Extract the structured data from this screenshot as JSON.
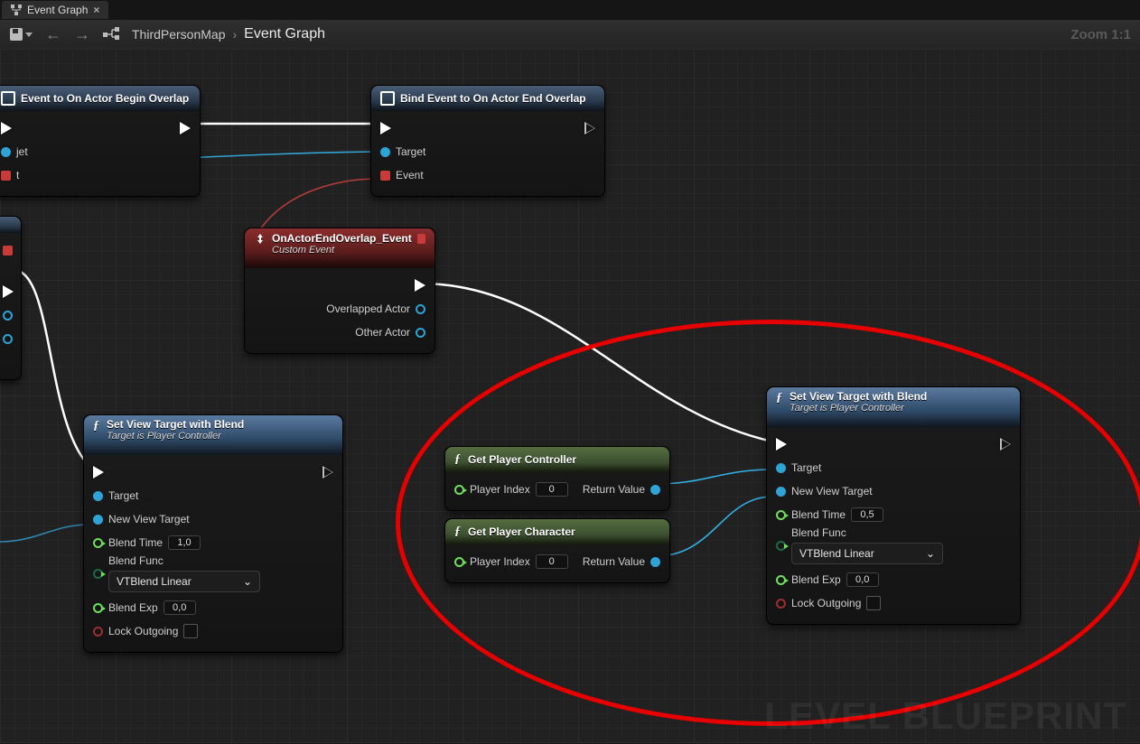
{
  "tabbar": {
    "tab_label": "Event Graph"
  },
  "toolbar": {
    "crumb_root": "ThirdPersonMap",
    "crumb_leaf": "Event Graph",
    "zoom_label": "Zoom 1:1"
  },
  "watermark": "LEVEL BLUEPRINT",
  "nodes": {
    "bind_begin": {
      "title": "Event to On Actor Begin Overlap",
      "pin_target": "jet",
      "pin_event": "t"
    },
    "bind_end": {
      "title": "Bind Event to On Actor End Overlap",
      "pin_target": "Target",
      "pin_event": "Event"
    },
    "custom_event": {
      "title": "OnActorEndOverlap_Event",
      "subtitle": "Custom Event",
      "out1": "Overlapped Actor",
      "out2": "Other Actor"
    },
    "svt_left": {
      "title": "Set View Target with Blend",
      "subtitle": "Target is Player Controller",
      "target": "Target",
      "new_view": "New View Target",
      "blend_time": "Blend Time",
      "blend_time_val": "1,0",
      "blend_func": "Blend Func",
      "blend_func_val": "VTBlend Linear",
      "blend_exp": "Blend Exp",
      "blend_exp_val": "0,0",
      "lock": "Lock Outgoing"
    },
    "svt_right": {
      "title": "Set View Target with Blend",
      "subtitle": "Target is Player Controller",
      "target": "Target",
      "new_view": "New View Target",
      "blend_time": "Blend Time",
      "blend_time_val": "0,5",
      "blend_func": "Blend Func",
      "blend_func_val": "VTBlend Linear",
      "blend_exp": "Blend Exp",
      "blend_exp_val": "0,0",
      "lock": "Lock Outgoing"
    },
    "gpc": {
      "title": "Get Player Controller",
      "player_index": "Player Index",
      "player_index_val": "0",
      "return": "Return Value"
    },
    "gpchar": {
      "title": "Get Player Character",
      "player_index": "Player Index",
      "player_index_val": "0",
      "return": "Return Value"
    }
  }
}
